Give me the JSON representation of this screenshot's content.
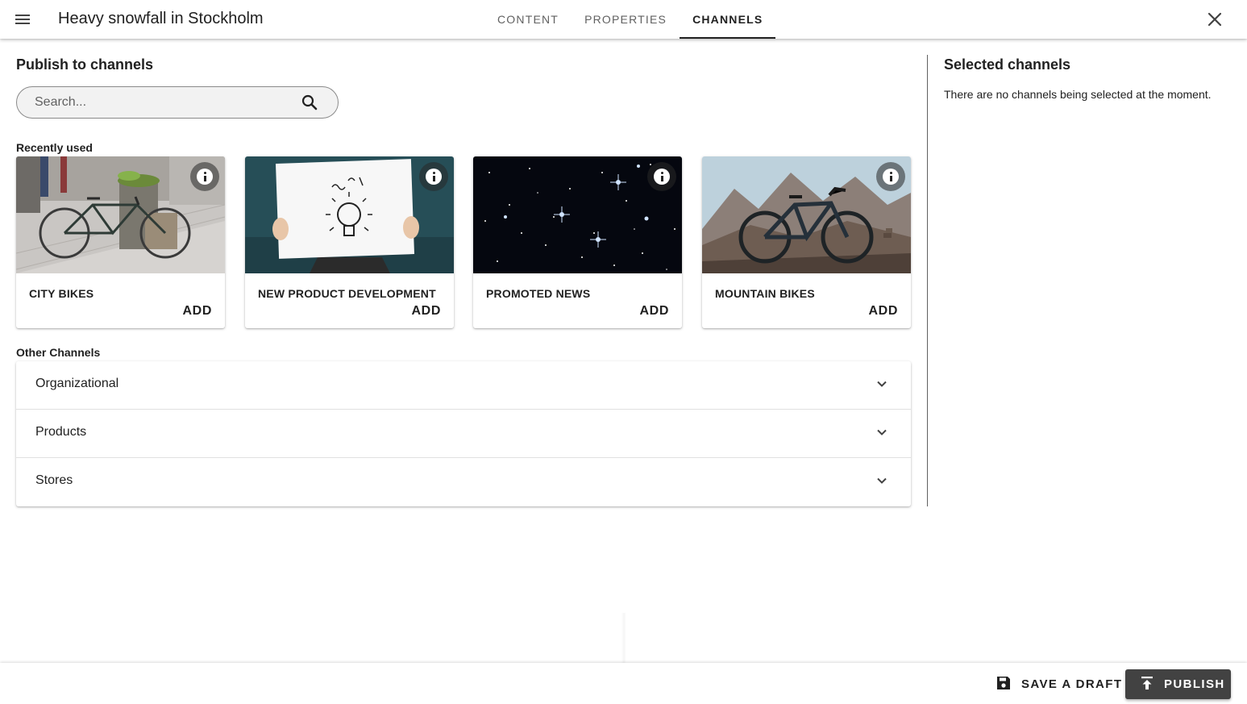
{
  "header": {
    "title": "Heavy snowfall in Stockholm",
    "tabs": [
      {
        "label": "CONTENT",
        "active": false
      },
      {
        "label": "PROPERTIES",
        "active": false
      },
      {
        "label": "CHANNELS",
        "active": true
      }
    ],
    "icons": {
      "menu": "menu-icon",
      "close": "close-icon"
    }
  },
  "publish": {
    "title": "Publish to channels",
    "search": {
      "placeholder": "Search...",
      "value": "",
      "icon": "search-icon"
    },
    "recently_used_label": "Recently used",
    "cards": [
      {
        "title": "CITY BIKES",
        "action": "ADD",
        "image": "bicycle-leaning-on-planter-photo"
      },
      {
        "title": "NEW PRODUCT DEVELOPMENT",
        "action": "ADD",
        "image": "idea-lightbulb-sign-photo"
      },
      {
        "title": "PROMOTED NEWS",
        "action": "ADD",
        "image": "starry-night-sky-photo"
      },
      {
        "title": "MOUNTAIN BIKES",
        "action": "ADD",
        "image": "mountain-bike-photo"
      }
    ],
    "other_channels_label": "Other Channels",
    "groups": [
      {
        "label": "Organizational"
      },
      {
        "label": "Products"
      },
      {
        "label": "Stores"
      }
    ]
  },
  "selected": {
    "title": "Selected channels",
    "empty_text": "There are no channels being selected at the moment."
  },
  "footer": {
    "save_draft_label": "SAVE A DRAFT",
    "publish_label": "PUBLISH",
    "save_icon": "floppy-disk-icon",
    "publish_icon": "upload-arrow-icon"
  },
  "colors": {
    "primary_dark": "#424242",
    "text": "#212121",
    "muted_text": "#616161",
    "search_bg": "#f2f2f2"
  }
}
